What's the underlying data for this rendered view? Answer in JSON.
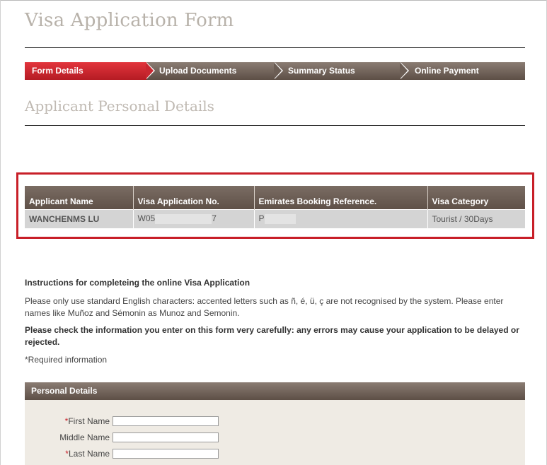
{
  "page": {
    "title": "Visa Application Form"
  },
  "steps": [
    {
      "label": "Form Details",
      "active": true
    },
    {
      "label": "Upload Documents",
      "active": false
    },
    {
      "label": "Summary Status",
      "active": false
    },
    {
      "label": "Online Payment",
      "active": false
    }
  ],
  "section": {
    "title": "Applicant Personal Details"
  },
  "summary": {
    "headers": [
      "Applicant Name",
      "Visa Application No.",
      "Emirates Booking Reference.",
      "Visa Category"
    ],
    "row": {
      "applicant_name": "WANCHENMS LU",
      "visa_no_prefix": "W05",
      "visa_no_suffix": "7",
      "booking_ref_prefix": "P",
      "visa_category": "Tourist / 30Days"
    }
  },
  "instructions": {
    "heading": "Instructions for completeing the online Visa Application",
    "paragraph": "Please only use standard English characters: accented letters such as ñ, é, ü, ç are not recognised by the system. Please enter names like Muñoz and Sémonin as Munoz and Semonin.",
    "warning": "Please check the information you enter on this form very carefully: any errors may cause your application to be delayed or rejected.",
    "required_note": "*Required information"
  },
  "personal_details": {
    "header": "Personal Details",
    "fields": [
      {
        "label": "First Name",
        "required": "*",
        "value": ""
      },
      {
        "label": "Middle Name",
        "required": "",
        "value": ""
      },
      {
        "label": "Last Name",
        "required": "*",
        "value": ""
      }
    ]
  },
  "colors": {
    "accent_red": "#c81f28",
    "bar_brown": "#6b5d54",
    "panel_beige": "#efebe4",
    "title_grey": "#b8b2aa"
  }
}
